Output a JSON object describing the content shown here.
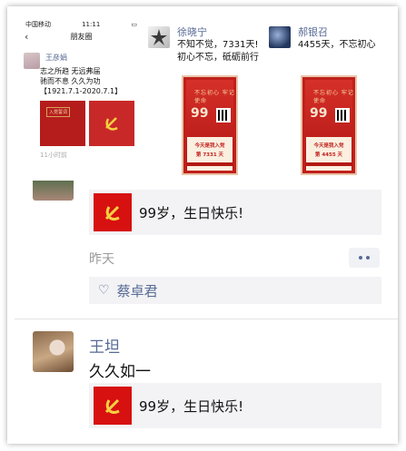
{
  "phone": {
    "carrier": "中国移动",
    "wifi_icon": "wifi-icon",
    "clock": "11:11",
    "nav_title": "朋友圈",
    "back_icon": "chevron-left-icon",
    "post": {
      "name": "王彦娟",
      "lines": [
        "志之所趋 无远弗届",
        "驰而不息 久久为功",
        "【1921.7.1-2020.7.1】"
      ],
      "image_tag": "入党誓词",
      "time": "11小时前"
    }
  },
  "card1": {
    "name": "徐晓宁",
    "lines": [
      "不知不觉，7331天!",
      "初心不忘，砥砺前行"
    ],
    "poster": {
      "slogan": "不忘初心 牢记使命",
      "num": "99",
      "line1": "今天是我入党",
      "line2": "第 7331 天"
    }
  },
  "card2": {
    "name": "郝银召",
    "lines": [
      "4455天，不忘初心"
    ],
    "poster": {
      "slogan": "不忘初心 牢记使命",
      "num": "99",
      "line1": "今天是我入党",
      "line2": "第 4455 天"
    }
  },
  "feed": {
    "share_title": "99岁，生日快乐!",
    "time": "昨天",
    "more_icon": "more-dots-icon",
    "like_icon": "heart-outline-icon",
    "like_name": "蔡卓君",
    "post2": {
      "name": "王坦",
      "text": "久久如一",
      "share_title": "99岁，生日快乐!"
    }
  },
  "colors": {
    "link_blue": "#576b95",
    "party_red": "#d71010",
    "share_bg": "#f3f3f5",
    "time_gray": "#9a9a9a"
  }
}
